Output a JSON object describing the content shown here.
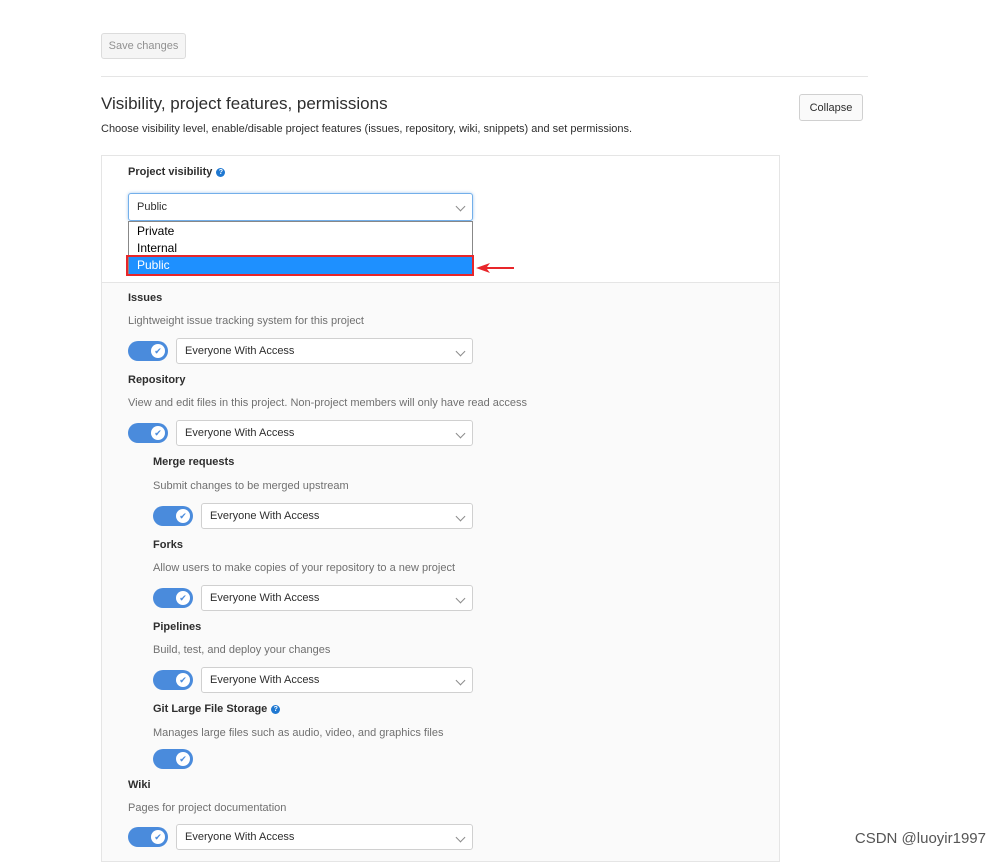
{
  "header": {
    "save_label": "Save changes"
  },
  "section": {
    "title": "Visibility, project features, permissions",
    "description": "Choose visibility level, enable/disable project features (issues, repository, wiki, snippets) and set permissions.",
    "collapse_label": "Collapse"
  },
  "visibility": {
    "label": "Project visibility",
    "help_glyph": "?",
    "selected": "Public",
    "options": [
      "Private",
      "Internal",
      "Public"
    ]
  },
  "features": {
    "issues": {
      "label": "Issues",
      "help": "Lightweight issue tracking system for this project",
      "access": "Everyone With Access",
      "enabled": true
    },
    "repository": {
      "label": "Repository",
      "help": "View and edit files in this project. Non-project members will only have read access",
      "access": "Everyone With Access",
      "enabled": true
    },
    "merge_requests": {
      "label": "Merge requests",
      "help": "Submit changes to be merged upstream",
      "access": "Everyone With Access",
      "enabled": true
    },
    "forks": {
      "label": "Forks",
      "help": "Allow users to make copies of your repository to a new project",
      "access": "Everyone With Access",
      "enabled": true
    },
    "pipelines": {
      "label": "Pipelines",
      "help": "Build, test, and deploy your changes",
      "access": "Everyone With Access",
      "enabled": true
    },
    "lfs": {
      "label": "Git Large File Storage",
      "help_glyph": "?",
      "help": "Manages large files such as audio, video, and graphics files",
      "enabled": true
    },
    "wiki": {
      "label": "Wiki",
      "help": "Pages for project documentation",
      "access": "Everyone With Access",
      "enabled": true
    }
  },
  "toggle_check": "✔",
  "watermark": "CSDN @luoyir1997",
  "colors": {
    "accent": "#1f78d1",
    "toggle": "#4a8bdc",
    "selected_option": "#1e90ff",
    "annotation_red": "#e8262a"
  }
}
